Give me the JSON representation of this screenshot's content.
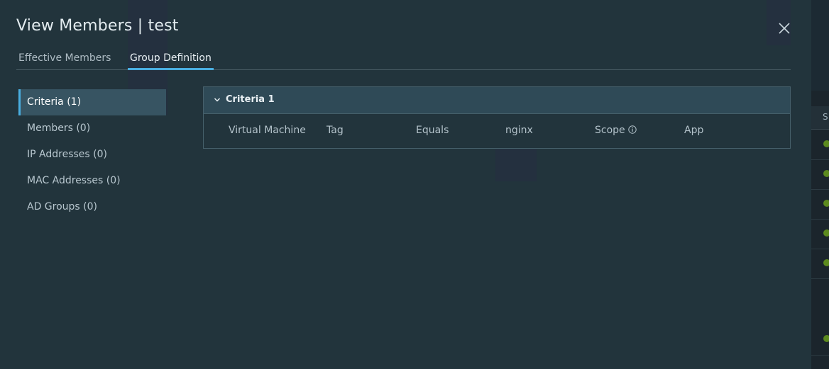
{
  "modal": {
    "title": "View Members | test"
  },
  "tabs": [
    {
      "label": "Effective Members",
      "active": false
    },
    {
      "label": "Group Definition",
      "active": true
    }
  ],
  "sidebar": {
    "items": [
      {
        "label": "Criteria (1)",
        "active": true
      },
      {
        "label": "Members (0)",
        "active": false
      },
      {
        "label": "IP Addresses (0)",
        "active": false
      },
      {
        "label": "MAC Addresses (0)",
        "active": false
      },
      {
        "label": "AD Groups (0)",
        "active": false
      }
    ]
  },
  "criteria": {
    "title": "Criteria 1",
    "member_type": "Virtual Machine",
    "property": "Tag",
    "operator": "Equals",
    "value": "nginx",
    "scope_label": "Scope",
    "scope_value": "App"
  },
  "background": {
    "column_header": "S"
  },
  "icons": {
    "close": "close-icon",
    "chevron": "chevron-down-icon",
    "info": "info-icon"
  },
  "colors": {
    "accent": "#49aee0",
    "modal_bg": "#22343c",
    "status_green": "#5c8a1e"
  }
}
